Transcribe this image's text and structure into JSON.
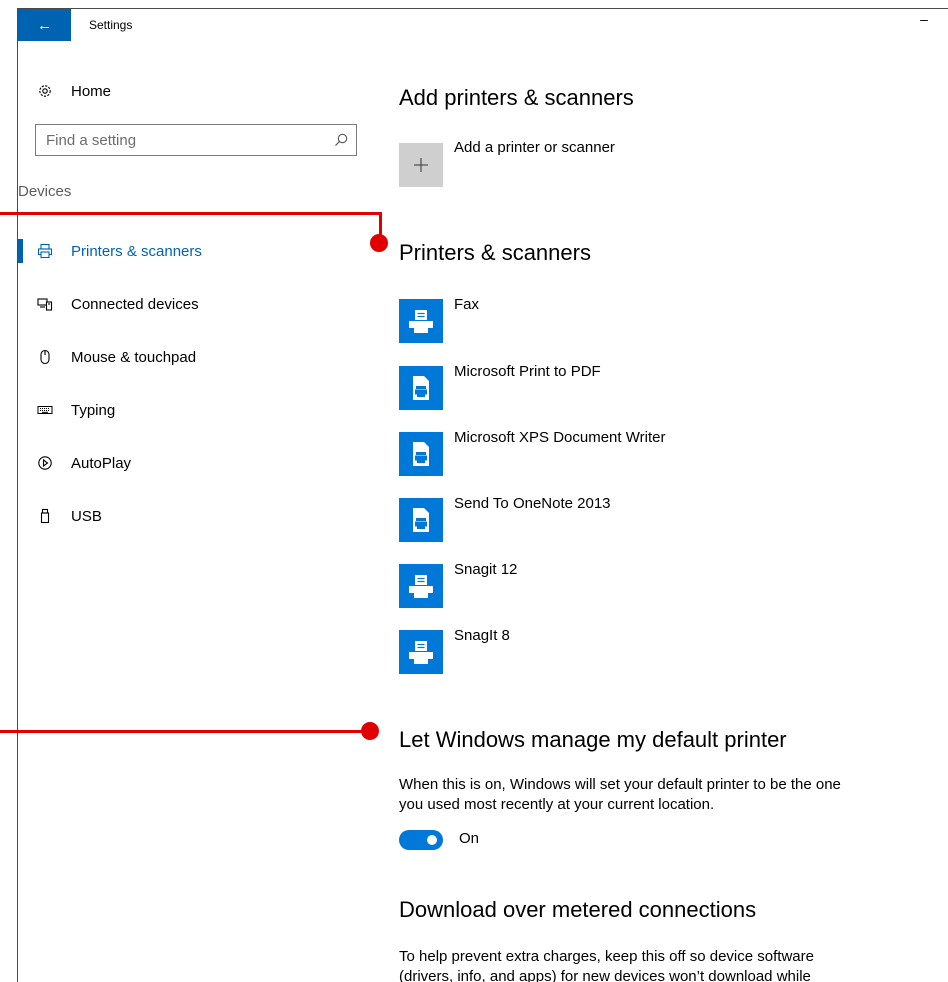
{
  "window": {
    "title": "Settings",
    "back_glyph": "←",
    "minimize_glyph": "–"
  },
  "sidebar": {
    "home_label": "Home",
    "search_placeholder": "Find a setting",
    "section_label": "Devices",
    "items": [
      {
        "label": "Printers & scanners",
        "icon": "printer-icon",
        "active": true
      },
      {
        "label": "Connected devices",
        "icon": "connected-devices-icon",
        "active": false
      },
      {
        "label": "Mouse & touchpad",
        "icon": "mouse-icon",
        "active": false
      },
      {
        "label": "Typing",
        "icon": "keyboard-icon",
        "active": false
      },
      {
        "label": "AutoPlay",
        "icon": "autoplay-icon",
        "active": false
      },
      {
        "label": "USB",
        "icon": "usb-icon",
        "active": false
      }
    ]
  },
  "content": {
    "add_heading": "Add printers & scanners",
    "add_button_label": "Add a printer or scanner",
    "printers_heading": "Printers & scanners",
    "printers": [
      {
        "name": "Fax",
        "icon": "printer-icon"
      },
      {
        "name": "Microsoft Print to PDF",
        "icon": "document-printer-icon"
      },
      {
        "name": "Microsoft XPS Document Writer",
        "icon": "document-printer-icon"
      },
      {
        "name": "Send To OneNote 2013",
        "icon": "document-printer-icon"
      },
      {
        "name": "Snagit 12",
        "icon": "printer-icon"
      },
      {
        "name": "SnagIt 8",
        "icon": "printer-icon"
      }
    ],
    "default_printer_heading": "Let Windows manage my default printer",
    "default_printer_text": "When this is on, Windows will set your default printer to be the one you used most recently at your current location.",
    "toggle_state": "On",
    "metered_heading": "Download over metered connections",
    "metered_text": "To help prevent extra charges, keep this off so device software (drivers, info, and apps) for new devices won’t download while"
  },
  "colors": {
    "accent": "#0063b1",
    "tile_blue": "#0078d7",
    "annotation_red": "#e00000"
  }
}
